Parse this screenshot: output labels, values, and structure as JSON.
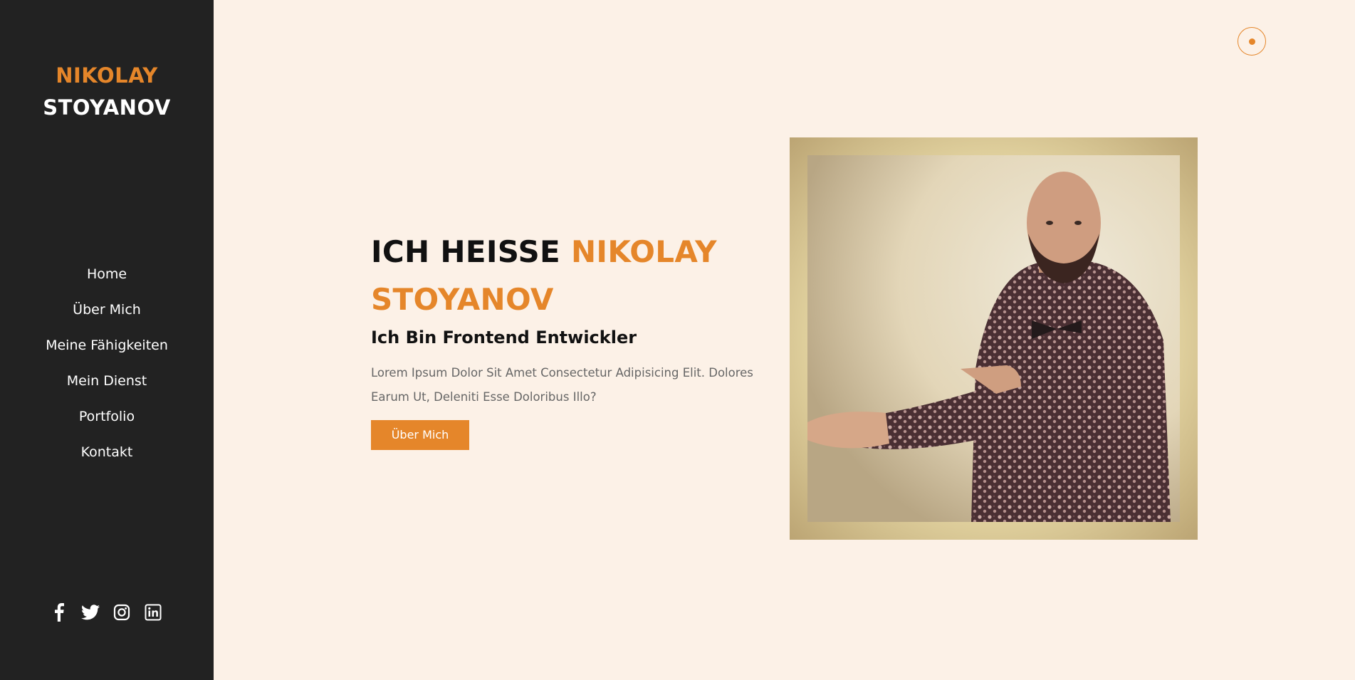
{
  "sidebar": {
    "logo_first": "NIKOLAY",
    "logo_last": "STOYANOV",
    "nav": [
      {
        "label": "Home"
      },
      {
        "label": "Über Mich"
      },
      {
        "label": "Meine Fähigkeiten"
      },
      {
        "label": "Mein Dienst"
      },
      {
        "label": "Portfolio"
      },
      {
        "label": "Kontakt"
      }
    ],
    "socials": [
      "facebook-icon",
      "twitter-icon",
      "instagram-icon",
      "linkedin-icon"
    ]
  },
  "hero": {
    "title_prefix": "ICH HEISSE",
    "title_accent_1": "NIKOLAY",
    "title_accent_2": "STOYANOV",
    "subtitle": "Ich Bin Frontend Entwickler",
    "description": "Lorem Ipsum Dolor Sit Amet Consectetur Adipisicing Elit. Dolores Earum Ut, Deleniti Esse Doloribus Illo?",
    "button_label": "Über Mich"
  },
  "colors": {
    "accent": "#e5862a",
    "sidebar_bg": "#222222",
    "page_bg": "#fcf1e7"
  },
  "icons": {
    "theme_toggle": "theme-toggle-icon",
    "photo": "profile-photo"
  }
}
